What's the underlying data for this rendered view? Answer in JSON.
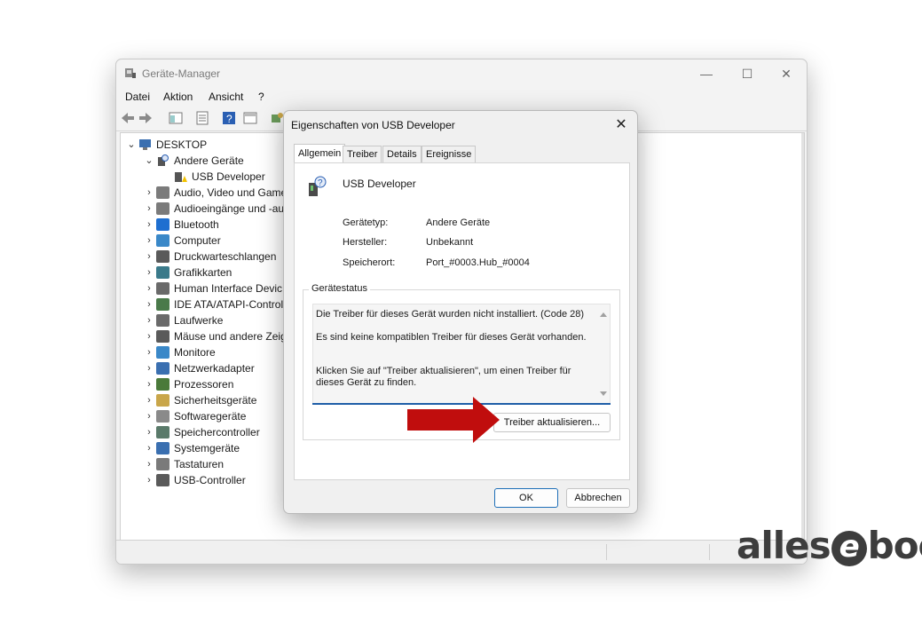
{
  "main_window": {
    "title": "Geräte-Manager",
    "minimize": "—",
    "maximize": "☐",
    "close": "✕"
  },
  "menu": [
    "Datei",
    "Aktion",
    "Ansicht",
    "?"
  ],
  "tree": {
    "root": "DESKTOP",
    "other_devices": "Andere Geräte",
    "usb_developer": "USB Developer",
    "categories": [
      "Audio, Video und Game",
      "Audioeingänge und -au",
      "Bluetooth",
      "Computer",
      "Druckwarteschlangen",
      "Grafikkarten",
      "Human Interface Devic",
      "IDE ATA/ATAPI-Controll",
      "Laufwerke",
      "Mäuse und andere Zeig",
      "Monitore",
      "Netzwerkadapter",
      "Prozessoren",
      "Sicherheitsgeräte",
      "Softwaregeräte",
      "Speichercontroller",
      "Systemgeräte",
      "Tastaturen",
      "USB-Controller"
    ]
  },
  "dialog": {
    "title": "Eigenschaften von USB Developer",
    "close": "✕",
    "tabs": [
      "Allgemein",
      "Treiber",
      "Details",
      "Ereignisse"
    ],
    "device_name": "USB Developer",
    "properties": [
      {
        "label": "Gerätetyp:",
        "value": "Andere Geräte"
      },
      {
        "label": "Hersteller:",
        "value": "Unbekannt"
      },
      {
        "label": "Speicherort:",
        "value": "Port_#0003.Hub_#0004"
      }
    ],
    "status_group_title": "Gerätestatus",
    "status_lines": [
      "Die Treiber für dieses Gerät wurden nicht installiert. (Code 28)",
      "Es sind keine kompatiblen Treiber für dieses Gerät vorhanden.",
      "Klicken Sie auf \"Treiber aktualisieren\", um einen Treiber für dieses Gerät zu finden."
    ],
    "update_driver_button": "Treiber aktualisieren...",
    "ok_button": "OK",
    "cancel_button": "Abbrechen"
  },
  "watermark": {
    "prefix": "alles",
    "e": "e",
    "suffix": "book"
  },
  "colors": {
    "arrow": "#c00d0d",
    "accent": "#1e6fb8"
  }
}
